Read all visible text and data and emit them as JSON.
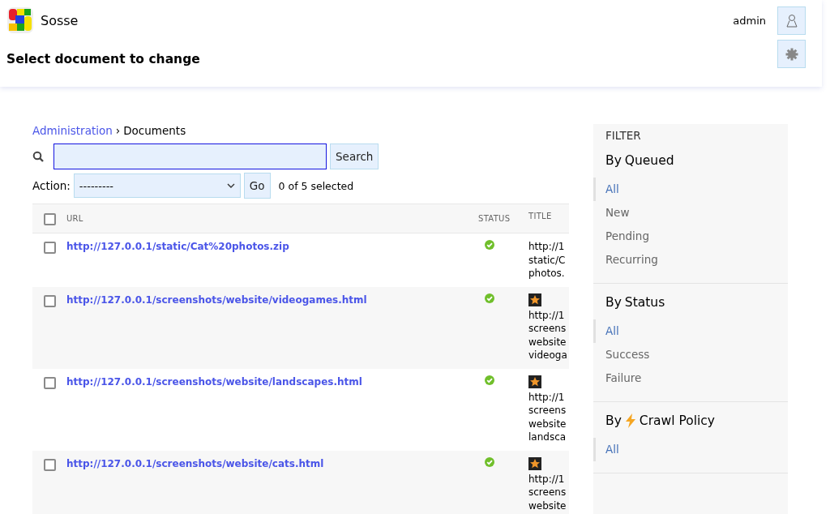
{
  "header": {
    "brand": "Sosse",
    "user": "admin",
    "page_title": "Select document to change"
  },
  "breadcrumbs": [
    "Administration",
    "Documents"
  ],
  "breadcrumb_separator": "›",
  "search": {
    "button": "Search"
  },
  "actions": {
    "label": "Action:",
    "value": "---------",
    "go": "Go",
    "counter": "0 of 5 selected"
  },
  "table": {
    "columns": [
      "URL",
      "STATUS",
      "TITLE"
    ],
    "header_checked": false,
    "rows": [
      {
        "checked": false,
        "url": "http://127.0.0.1/static/Cat%20photos.zip",
        "ok": true,
        "favicon": false,
        "title_lines": [
          "http://1",
          "static/C",
          "photos."
        ]
      },
      {
        "checked": false,
        "url": "http://127.0.0.1/screenshots/website/videogames.html",
        "ok": true,
        "favicon": true,
        "title_lines": [
          "http://1",
          "screens",
          "website",
          "videoga"
        ]
      },
      {
        "checked": false,
        "url": "http://127.0.0.1/screenshots/website/landscapes.html",
        "ok": true,
        "favicon": true,
        "title_lines": [
          "http://1",
          "screens",
          "website",
          "landsca"
        ]
      },
      {
        "checked": false,
        "url": "http://127.0.0.1/screenshots/website/cats.html",
        "ok": true,
        "favicon": true,
        "title_lines": [
          "http://1",
          "screens",
          "website"
        ]
      }
    ]
  },
  "filter": {
    "title": "FILTER",
    "groups": [
      {
        "before": "By",
        "kind": "plain",
        "title": "Queued",
        "options": [
          {
            "label": "All",
            "selected": true
          },
          {
            "label": "New",
            "selected": false
          },
          {
            "label": "Pending",
            "selected": false
          },
          {
            "label": "Recurring",
            "selected": false
          }
        ]
      },
      {
        "before": "By",
        "kind": "plain",
        "title": "Status",
        "options": [
          {
            "label": "All",
            "selected": true
          },
          {
            "label": "Success",
            "selected": false
          },
          {
            "label": "Failure",
            "selected": false
          }
        ]
      },
      {
        "before": "By",
        "kind": "crawl_policy",
        "title": "Crawl Policy",
        "options": [
          {
            "label": "All",
            "selected": true
          }
        ]
      }
    ]
  }
}
